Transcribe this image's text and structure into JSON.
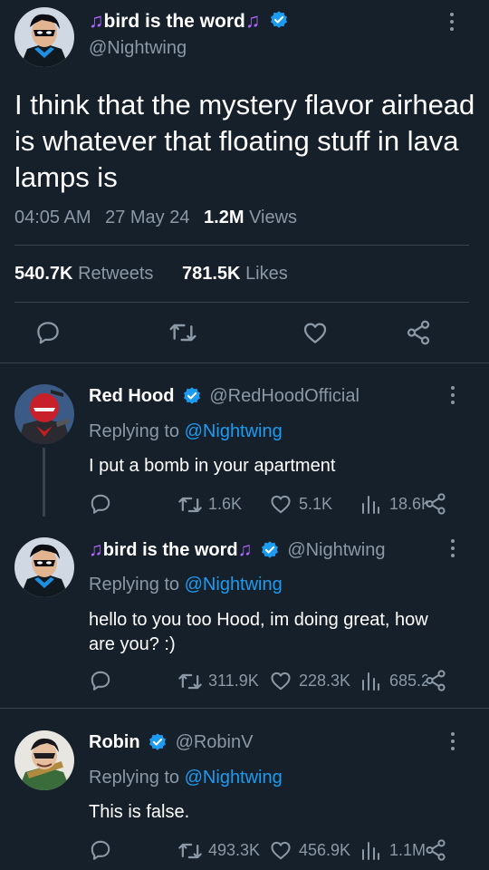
{
  "main_tweet": {
    "display_name": "bird is the word",
    "name_prefix_icon": "music-note",
    "name_suffix_icon": "music-note",
    "handle": "@Nightwing",
    "text": "I think that the mystery flavor airhead is whatever that floating stuff in lava lamps is",
    "time": "04:05 AM",
    "date": "27 May 24",
    "views_count": "1.2M",
    "views_label": "Views",
    "retweets_count": "540.7K",
    "retweets_label": "Retweets",
    "likes_count": "781.5K",
    "likes_label": "Likes"
  },
  "replies": [
    {
      "display_name": "Red Hood",
      "handle": "@RedHoodOfficial",
      "replying_label": "Replying to",
      "replying_handle": "@Nightwing",
      "text": "I put a bomb in your apartment",
      "retweets": "1.6K",
      "likes": "5.1K",
      "views": "18.6K"
    },
    {
      "display_name": "bird is the word",
      "handle": "@Nightwing",
      "replying_label": "Replying to",
      "replying_handle": "@Nightwing",
      "text": "hello to you too Hood, im doing great, how are you? :)",
      "retweets": "311.9K",
      "likes": "228.3K",
      "views": "685.2K"
    },
    {
      "display_name": "Robin",
      "handle": "@RobinV",
      "replying_label": "Replying to",
      "replying_handle": "@Nightwing",
      "text": "This is false.",
      "retweets": "493.3K",
      "likes": "456.9K",
      "views": "1.1M"
    }
  ],
  "colors": {
    "background": "#15202b",
    "accent": "#1d9bf0",
    "secondary_text": "#8b98a5",
    "music_note": "#b266ff",
    "divider": "#38444d"
  },
  "icons": [
    "reply-icon",
    "retweet-icon",
    "like-icon",
    "share-icon",
    "views-icon",
    "verified-badge-icon",
    "more-icon"
  ]
}
